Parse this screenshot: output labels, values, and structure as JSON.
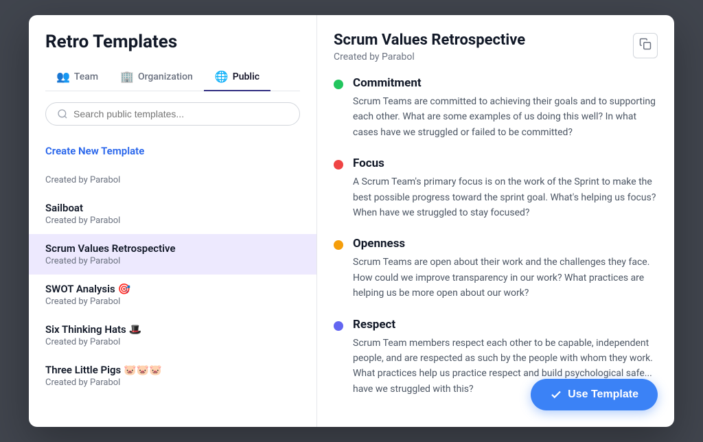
{
  "modal": {
    "title": "Retro Templates"
  },
  "tabs": [
    {
      "id": "team",
      "label": "Team",
      "icon": "👥",
      "active": false
    },
    {
      "id": "organization",
      "label": "Organization",
      "icon": "🏢",
      "active": false
    },
    {
      "id": "public",
      "label": "Public",
      "icon": "🌐",
      "active": true
    }
  ],
  "search": {
    "placeholder": "Search public templates..."
  },
  "create_new": {
    "label": "Create New Template"
  },
  "templates": [
    {
      "id": "create",
      "name": "Create New Template",
      "author": "",
      "selected": false,
      "is_create": true
    },
    {
      "id": "parabol1",
      "name": "",
      "author": "Created by Parabol",
      "selected": false,
      "is_create": false,
      "name_only": ""
    },
    {
      "id": "sailboat",
      "name": "Sailboat",
      "author": "Created by Parabol",
      "selected": false,
      "is_create": false
    },
    {
      "id": "scrum-values",
      "name": "Scrum Values Retrospective",
      "author": "Created by Parabol",
      "selected": true,
      "is_create": false
    },
    {
      "id": "swot",
      "name": "SWOT Analysis 🎯",
      "author": "Created by Parabol",
      "selected": false,
      "is_create": false
    },
    {
      "id": "six-hats",
      "name": "Six Thinking Hats 🎩",
      "author": "Created by Parabol",
      "selected": false,
      "is_create": false
    },
    {
      "id": "three-pigs",
      "name": "Three Little Pigs 🐷🐷🐷",
      "author": "Created by Parabol",
      "selected": false,
      "is_create": false
    }
  ],
  "detail": {
    "title": "Scrum Values Retrospective",
    "subtitle": "Created by Parabol",
    "values": [
      {
        "id": "commitment",
        "dot_color": "#22c55e",
        "title": "Commitment",
        "description": "Scrum Teams are committed to achieving their goals and to supporting each other. What are some examples of us doing this well? In what cases have we struggled or failed to be committed?"
      },
      {
        "id": "focus",
        "dot_color": "#ef4444",
        "title": "Focus",
        "description": "A Scrum Team's primary focus is on the work of the Sprint to make the best possible progress toward the sprint goal. What's helping us focus? When have we struggled to stay focused?"
      },
      {
        "id": "openness",
        "dot_color": "#f59e0b",
        "title": "Openness",
        "description": "Scrum Teams are open about their work and the challenges they face. How could we improve transparency in our work? What practices are helping us be more open about our work?"
      },
      {
        "id": "respect",
        "dot_color": "#6366f1",
        "title": "Respect",
        "description": "Scrum Team members respect each other to be capable, independent people, and are respected as such by the people with whom they work. What practices help us practice respect and build psychological safe... have we struggled with this?"
      }
    ],
    "use_template_label": "Use Template"
  },
  "icons": {
    "search": "🔍",
    "copy": "⧉",
    "check": "✓"
  }
}
